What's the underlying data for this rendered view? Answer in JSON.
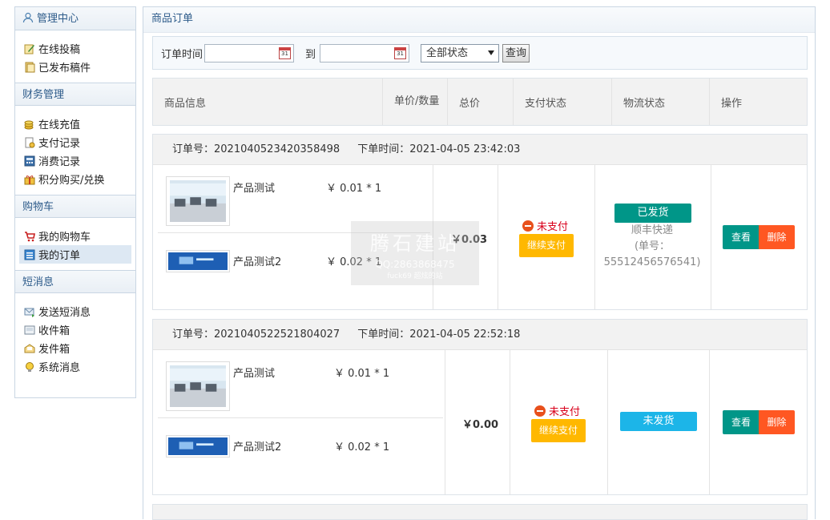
{
  "sidebar": {
    "header": "管理中心",
    "group1": [
      "在线投稿",
      "已发布稿件"
    ],
    "finance_header": "财务管理",
    "finance": [
      "在线充值",
      "支付记录",
      "消费记录",
      "积分购买/兑换"
    ],
    "cart_header": "购物车",
    "cart": [
      "我的购物车",
      "我的订单"
    ],
    "msg_header": "短消息",
    "msg": [
      "发送短消息",
      "收件箱",
      "发件箱",
      "系统消息"
    ]
  },
  "main": {
    "title": "商品订单",
    "filter": {
      "order_time_label": "订单时间",
      "to_label": "到",
      "calendar_text": "31",
      "status_selected": "全部状态",
      "query_button": "查询"
    },
    "columns": [
      "商品信息",
      "单价/数量",
      "总价",
      "支付状态",
      "物流状态",
      "操作"
    ]
  },
  "orders": [
    {
      "order_no_label": "订单号：2021040523420358498",
      "time_label": "下单时间：2021-04-05 23:42:03",
      "items": [
        {
          "name": "产品测试",
          "price": "￥ 0.01 * 1"
        },
        {
          "name": "产品测试2",
          "price": "￥ 0.02 * 1"
        }
      ],
      "total": "￥0.03",
      "pay_status": "未支付",
      "pay_button": "继续支付",
      "ship_status": "已发货",
      "ship_company": "顺丰快递",
      "ship_no_label": "(单号：",
      "ship_no": "55512456576541)",
      "view_button": "查看",
      "delete_button": "删除"
    },
    {
      "order_no_label": "订单号：2021040522521804027",
      "time_label": "下单时间：2021-04-05 22:52:18",
      "items": [
        {
          "name": "产品测试",
          "price": "￥ 0.01 * 1"
        },
        {
          "name": "产品测试2",
          "price": "￥ 0.02 * 1"
        }
      ],
      "total": "￥0.00",
      "pay_status": "未支付",
      "pay_button": "继续支付",
      "ship_status": "未发货",
      "view_button": "查看",
      "delete_button": "删除"
    }
  ],
  "watermark": {
    "line1": "腾石建站",
    "line2": "QQ:2863868475",
    "line3": "fuck69 超炫的站"
  },
  "colors": {
    "accent": "#2d5b8a",
    "view": "#009688",
    "delete": "#ff5722",
    "pay": "#ffb800",
    "shipped": "#009688",
    "not_shipped": "#1cb5e8",
    "unpaid_text": "#d9001b"
  }
}
